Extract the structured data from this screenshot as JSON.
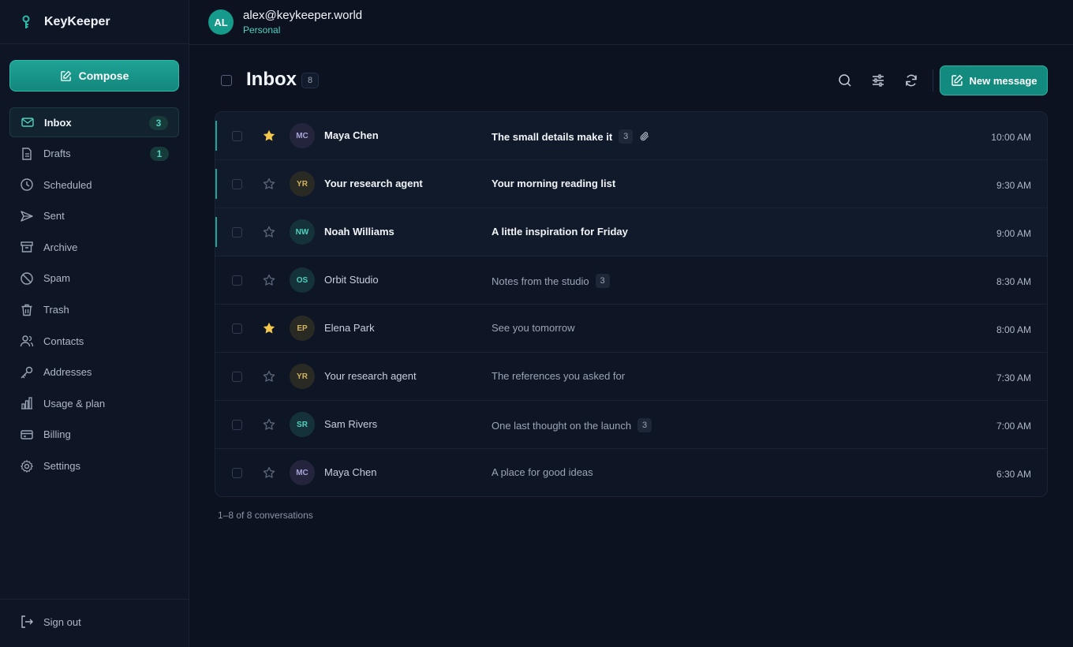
{
  "app": {
    "name": "KeyKeeper"
  },
  "sidebar": {
    "compose_label": "Compose",
    "items": [
      {
        "label": "Inbox",
        "icon": "mail-icon",
        "badge": "3",
        "active": true
      },
      {
        "label": "Drafts",
        "icon": "file-icon",
        "badge": "1"
      },
      {
        "label": "Scheduled",
        "icon": "clock-icon"
      },
      {
        "label": "Sent",
        "icon": "send-icon"
      },
      {
        "label": "Archive",
        "icon": "archive-icon"
      },
      {
        "label": "Spam",
        "icon": "ban-icon"
      },
      {
        "label": "Trash",
        "icon": "trash-icon"
      },
      {
        "label": "Contacts",
        "icon": "users-icon"
      },
      {
        "label": "Addresses",
        "icon": "key-icon"
      },
      {
        "label": "Usage & plan",
        "icon": "bar-chart-icon"
      },
      {
        "label": "Billing",
        "icon": "credit-card-icon"
      },
      {
        "label": "Settings",
        "icon": "gear-icon"
      }
    ],
    "signout_label": "Sign out"
  },
  "user": {
    "initials": "AL",
    "email": "alex@keykeeper.world",
    "plan": "Personal"
  },
  "inbox": {
    "title": "Inbox",
    "count": "8",
    "new_message_label": "New message",
    "footer": "1–8 of 8 conversations",
    "messages": [
      {
        "initials": "MC",
        "sender": "Maya Chen",
        "subject": "The small details make it",
        "thread_count": "3",
        "attachment": true,
        "starred": true,
        "unread": true,
        "time": "10:00 AM",
        "tone": "mc"
      },
      {
        "initials": "YR",
        "sender": "Your research agent",
        "subject": "Your morning reading list",
        "starred": false,
        "unread": true,
        "time": "9:30 AM",
        "tone": "yr"
      },
      {
        "initials": "NW",
        "sender": "Noah Williams",
        "subject": "A little inspiration for Friday",
        "starred": false,
        "unread": true,
        "time": "9:00 AM",
        "tone": "nw"
      },
      {
        "initials": "OS",
        "sender": "Orbit Studio",
        "subject": "Notes from the studio",
        "thread_count": "3",
        "starred": false,
        "unread": false,
        "time": "8:30 AM",
        "tone": "os"
      },
      {
        "initials": "EP",
        "sender": "Elena Park",
        "subject": "See you tomorrow",
        "starred": true,
        "unread": false,
        "time": "8:00 AM",
        "tone": "ep"
      },
      {
        "initials": "YR",
        "sender": "Your research agent",
        "subject": "The references you asked for",
        "starred": false,
        "unread": false,
        "time": "7:30 AM",
        "tone": "yr"
      },
      {
        "initials": "SR",
        "sender": "Sam Rivers",
        "subject": "One last thought on the launch",
        "thread_count": "3",
        "starred": false,
        "unread": false,
        "time": "7:00 AM",
        "tone": "sr"
      },
      {
        "initials": "MC",
        "sender": "Maya Chen",
        "subject": "A place for good ideas",
        "starred": false,
        "unread": false,
        "time": "6:30 AM",
        "tone": "mc"
      }
    ]
  },
  "colors": {
    "accent": "#1ea395",
    "background": "#0c1220",
    "star": "#f5c84b"
  }
}
